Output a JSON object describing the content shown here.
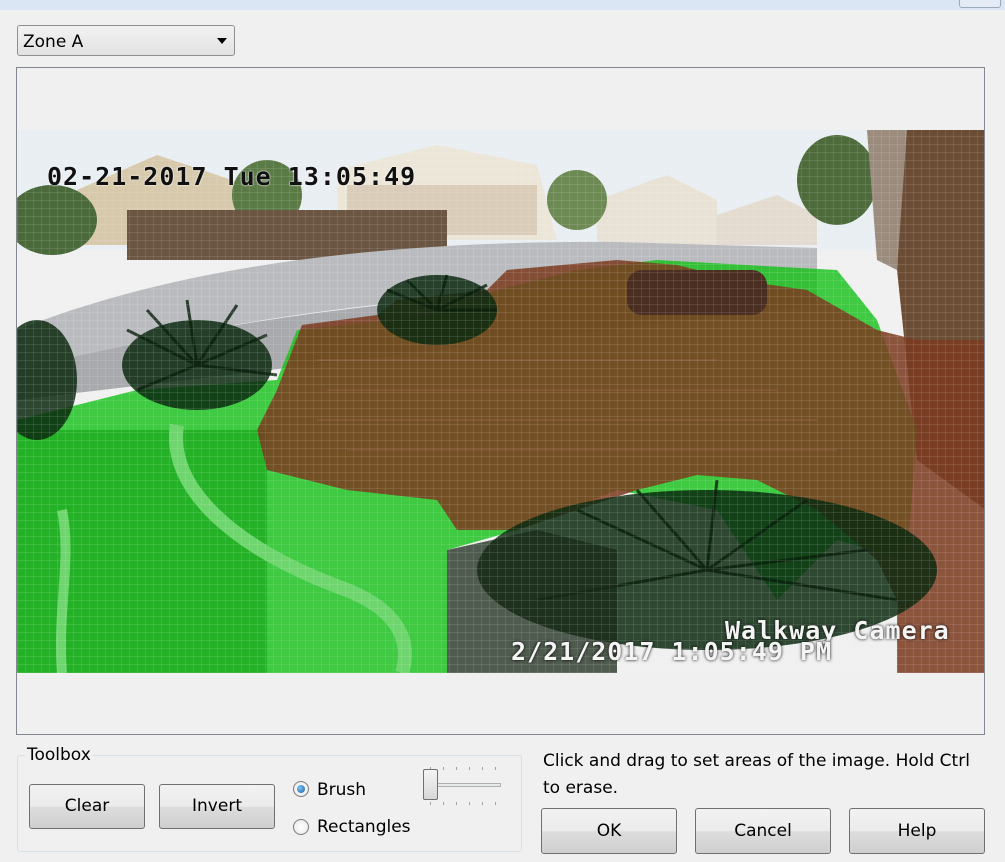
{
  "window": {
    "close_icon": "close-icon"
  },
  "zone_select": {
    "value": "Zone A",
    "icon": "chevron-down-icon"
  },
  "camera_view": {
    "timestamp_top": "02-21-2017 Tue 13:05:49",
    "camera_name": "Walkway Camera",
    "timestamp_bottom": "2/21/2017 1:05:49 PM"
  },
  "toolbox": {
    "title": "Toolbox",
    "clear_label": "Clear",
    "invert_label": "Invert",
    "brush_label": "Brush",
    "rectangles_label": "Rectangles",
    "selected_tool": "Brush",
    "brush_size_level": 0
  },
  "instructions": "Click and drag to set areas of the image.  Hold Ctrl to erase.",
  "buttons": {
    "ok": "OK",
    "cancel": "Cancel",
    "help": "Help"
  },
  "colors": {
    "zone_selected": "#7a1f1f",
    "zone_unselected": "#18c21a"
  }
}
